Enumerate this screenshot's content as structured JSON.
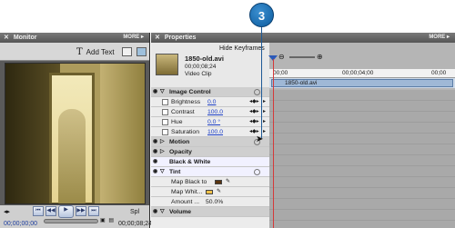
{
  "callout": {
    "number": "3"
  },
  "monitor": {
    "title": "Monitor",
    "more_label": "MORE ▸",
    "add_text_label": "Add Text",
    "current_time": "00;00;00;00",
    "duration": "00;00;08;24",
    "split_label": "Spl"
  },
  "properties": {
    "title": "Properties",
    "more_label": "MORE ▸",
    "hide_keyframes_label": "Hide Keyframes",
    "clip": {
      "name": "1850-old.avi",
      "duration": "00;00;08;24",
      "type": "Video Clip"
    },
    "ruler": {
      "start": "00;00",
      "mid": "00;00;04;00",
      "end": "00;00"
    },
    "timeline_clip_label": "1850-old.avi",
    "image_control": {
      "label": "Image Control",
      "params": [
        {
          "name": "Brightness",
          "value": "0.0"
        },
        {
          "name": "Contrast",
          "value": "100.0"
        },
        {
          "name": "Hue",
          "value": "0.0 °"
        },
        {
          "name": "Saturation",
          "value": "100.0"
        }
      ]
    },
    "motion_label": "Motion",
    "opacity_label": "Opacity",
    "bw_label": "Black & White",
    "tint": {
      "label": "Tint",
      "map_black_label": "Map Black to",
      "map_white_label": "Map Whit...",
      "amount_label": "Amount ...",
      "amount_value": "50.0%",
      "map_black_color": "#5a3410",
      "map_white_color": "#f1c24a"
    },
    "volume_label": "Volume"
  }
}
